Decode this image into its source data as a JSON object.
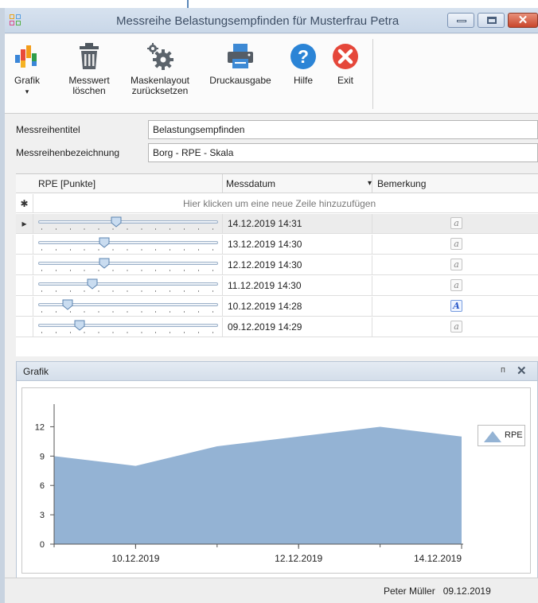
{
  "window": {
    "title": "Messreihe Belastungsempfinden für Musterfrau Petra",
    "controls": {
      "minimize": "minimize",
      "maximize": "maximize",
      "close": "✕"
    }
  },
  "ribbon": {
    "buttons": [
      {
        "id": "grafik",
        "label": "Grafik",
        "icon": "bar-chart-icon",
        "dropdown": "▾"
      },
      {
        "id": "messwert",
        "label1": "Messwert",
        "label2": "löschen",
        "icon": "trash-icon"
      },
      {
        "id": "masken",
        "label1": "Maskenlayout",
        "label2": "zurücksetzen",
        "icon": "gears-icon"
      },
      {
        "id": "druck",
        "label": "Druckausgabe",
        "icon": "printer-icon"
      },
      {
        "id": "hilfe",
        "label": "Hilfe",
        "icon": "help-icon",
        "glyph": "?"
      },
      {
        "id": "exit",
        "label": "Exit",
        "icon": "exit-icon",
        "glyph": "✕"
      }
    ]
  },
  "fields": {
    "title_label": "Messreihentitel",
    "title_value": "Belastungsempfinden",
    "name_label": "Messreihenbezeichnung",
    "name_value": "Borg - RPE - Skala"
  },
  "grid": {
    "columns": [
      "RPE [Punkte]",
      "Messdatum",
      "Bemerkung"
    ],
    "sort_glyph": "▾",
    "new_row_marker": "✱",
    "new_row_text": "Hier klicken um eine neue Zeile hinzuzufügen",
    "current_row_marker": "▸",
    "note_glyph": "a",
    "note_glyph_active": "A",
    "rows": [
      {
        "rpe": 12,
        "date": "14.12.2019 14:31",
        "selected": true,
        "note": false
      },
      {
        "rpe": 11,
        "date": "13.12.2019 14:30",
        "selected": false,
        "note": false
      },
      {
        "rpe": 11,
        "date": "12.12.2019 14:30",
        "selected": false,
        "note": false
      },
      {
        "rpe": 10,
        "date": "11.12.2019 14:30",
        "selected": false,
        "note": false
      },
      {
        "rpe": 8,
        "date": "10.12.2019 14:28",
        "selected": false,
        "note": true
      },
      {
        "rpe": 9,
        "date": "09.12.2019 14:29",
        "selected": false,
        "note": false
      }
    ],
    "slider_range": [
      6,
      20
    ]
  },
  "chart_panel": {
    "title": "Grafik",
    "pin_glyph": "ᴨ",
    "close_glyph": "✕"
  },
  "chart_data": {
    "type": "area",
    "x": [
      "09.12.2019",
      "10.12.2019",
      "11.12.2019",
      "12.12.2019",
      "13.12.2019",
      "14.12.2019",
      "14.12.2019"
    ],
    "x_days": [
      "09.12.2019",
      "10.12.2019",
      "11.12.2019",
      "12.12.2019",
      "13.12.2019",
      "14.12.2019"
    ],
    "series": [
      {
        "name": "RPE",
        "values": [
          9,
          8,
          10,
          11,
          12,
          11
        ]
      }
    ],
    "x_tick_labels": [
      "10.12.2019",
      "12.12.2019",
      "14.12.2019"
    ],
    "y_ticks": [
      0,
      3,
      6,
      9,
      12
    ],
    "ylim": [
      0,
      13.5
    ],
    "color": "#94b3d4",
    "legend_position": "top-right",
    "grid": false
  },
  "status": {
    "user": "Peter Müller",
    "date": "09.12.2019"
  }
}
